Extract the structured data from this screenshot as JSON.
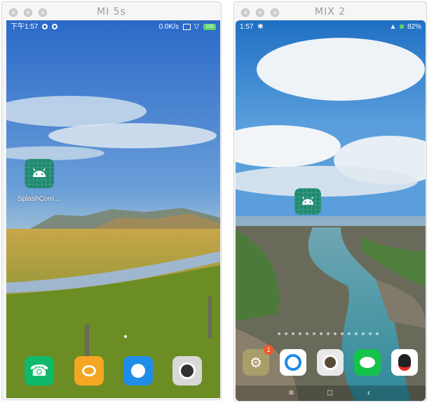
{
  "left_window": {
    "title": "MI 5s",
    "statusbar": {
      "time": "下午1:57",
      "speed": "0.0K/s",
      "battery": "100"
    },
    "desktop_app": {
      "label": "SplashCom..."
    },
    "dock": [
      {
        "name": "phone",
        "color": "#0fb96a"
      },
      {
        "name": "messages",
        "color": "#f5a623"
      },
      {
        "name": "browser",
        "color": "#1e8ce8"
      },
      {
        "name": "camera",
        "color": "#d8d8d8"
      }
    ]
  },
  "right_window": {
    "title": "MIX 2",
    "statusbar": {
      "time": "1:57",
      "battery": "82%"
    },
    "badge_count": "1",
    "dock": [
      {
        "name": "settings",
        "color": "#a99d6a"
      },
      {
        "name": "browser",
        "color": "#ffffff"
      },
      {
        "name": "camera",
        "color": "#e8e8e8"
      },
      {
        "name": "wechat",
        "color": "#15c24a"
      },
      {
        "name": "qq",
        "color": "#ffffff"
      }
    ]
  }
}
